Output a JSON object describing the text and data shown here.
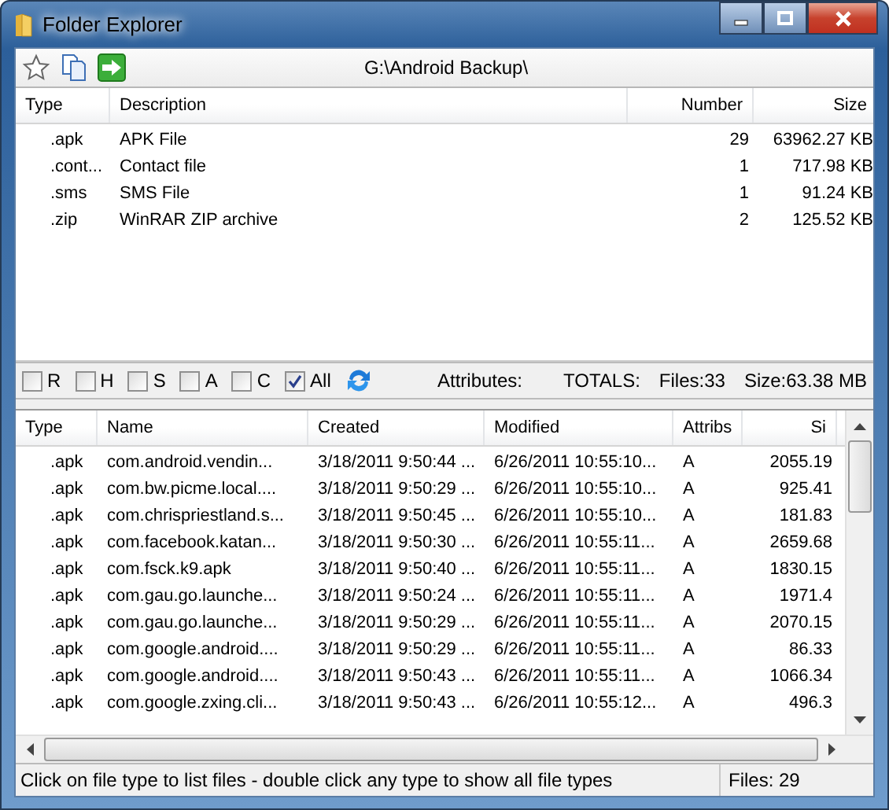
{
  "window": {
    "title": "Folder Explorer"
  },
  "toolbar": {
    "path": "G:\\Android Backup\\"
  },
  "type_table": {
    "columns": [
      "Type",
      "Description",
      "Number",
      "Size"
    ],
    "rows": [
      [
        ".apk",
        "APK File",
        "29",
        "63962.27 KB"
      ],
      [
        ".cont...",
        "Contact file",
        "1",
        "717.98 KB"
      ],
      [
        ".sms",
        "SMS File",
        "1",
        "91.24 KB"
      ],
      [
        ".zip",
        "WinRAR ZIP archive",
        "2",
        "125.52 KB"
      ]
    ]
  },
  "filters": [
    {
      "label": "R",
      "checked": false
    },
    {
      "label": "H",
      "checked": false
    },
    {
      "label": "S",
      "checked": false
    },
    {
      "label": "A",
      "checked": false
    },
    {
      "label": "C",
      "checked": false
    },
    {
      "label": "All",
      "checked": true
    }
  ],
  "totals": {
    "attributes_label": "Attributes:",
    "totals_label": "TOTALS:",
    "files": "Files:33",
    "size": "Size:63.38 MB"
  },
  "file_table": {
    "columns": [
      "Type",
      "Name",
      "Created",
      "Modified",
      "Attribs",
      "Si"
    ],
    "rows": [
      [
        ".apk",
        "com.android.vendin...",
        "3/18/2011 9:50:44 ...",
        "6/26/2011 10:55:10...",
        "A",
        "2055.19"
      ],
      [
        ".apk",
        "com.bw.picme.local....",
        "3/18/2011 9:50:29 ...",
        "6/26/2011 10:55:10...",
        "A",
        "925.41"
      ],
      [
        ".apk",
        "com.chrispriestland.s...",
        "3/18/2011 9:50:45 ...",
        "6/26/2011 10:55:10...",
        "A",
        "181.83"
      ],
      [
        ".apk",
        "com.facebook.katan...",
        "3/18/2011 9:50:30 ...",
        "6/26/2011 10:55:11...",
        "A",
        "2659.68"
      ],
      [
        ".apk",
        "com.fsck.k9.apk",
        "3/18/2011 9:50:40 ...",
        "6/26/2011 10:55:11...",
        "A",
        "1830.15"
      ],
      [
        ".apk",
        "com.gau.go.launche...",
        "3/18/2011 9:50:24 ...",
        "6/26/2011 10:55:11...",
        "A",
        "1971.4"
      ],
      [
        ".apk",
        "com.gau.go.launche...",
        "3/18/2011 9:50:29 ...",
        "6/26/2011 10:55:11...",
        "A",
        "2070.15"
      ],
      [
        ".apk",
        "com.google.android....",
        "3/18/2011 9:50:29 ...",
        "6/26/2011 10:55:11...",
        "A",
        "86.33"
      ],
      [
        ".apk",
        "com.google.android....",
        "3/18/2011 9:50:43 ...",
        "6/26/2011 10:55:11...",
        "A",
        "1066.34"
      ],
      [
        ".apk",
        "com.google.zxing.cli...",
        "3/18/2011 9:50:43 ...",
        "6/26/2011 10:55:12...",
        "A",
        "496.3"
      ]
    ]
  },
  "status_bar": {
    "message": "Click on file type to list files - double click any type to show all file types",
    "files": "Files: 29"
  }
}
